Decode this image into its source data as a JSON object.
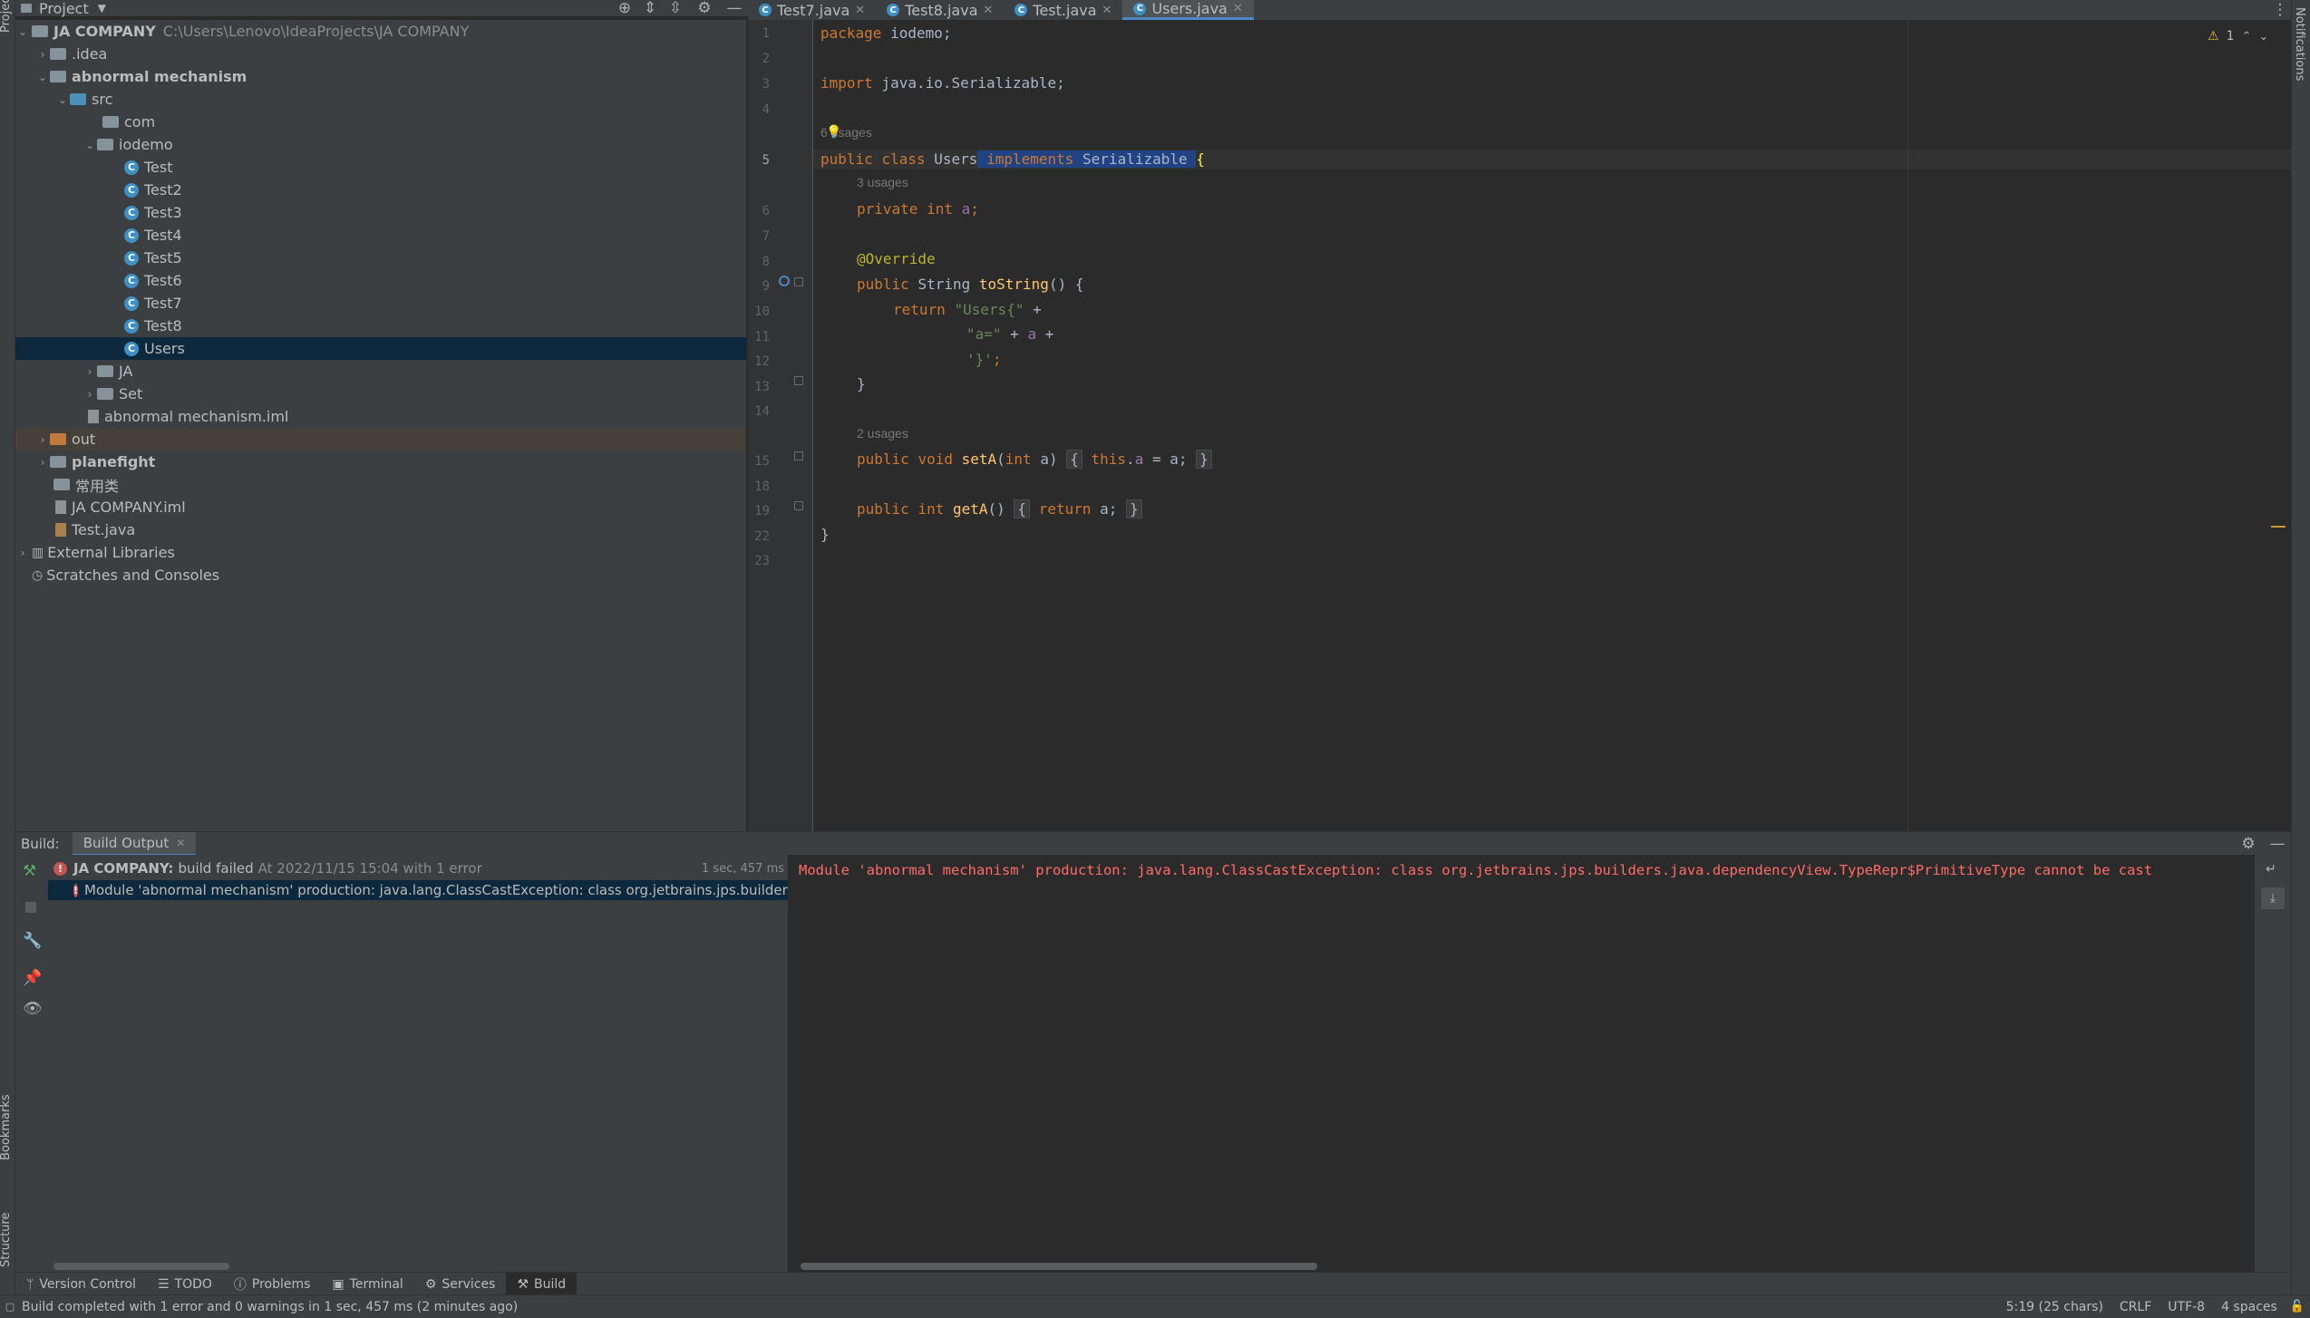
{
  "stripes": {
    "left_top": "Project",
    "left_bookmarks": "Bookmarks",
    "left_structure": "Structure",
    "right_notifications": "Notifications"
  },
  "project_panel": {
    "title": "Project",
    "tree": [
      {
        "label": "JA COMPANY",
        "path": "C:\\Users\\Lenovo\\IdeaProjects\\JA COMPANY"
      },
      {
        "label": ".idea"
      },
      {
        "label": "abnormal mechanism"
      },
      {
        "label": "src"
      },
      {
        "label": "com"
      },
      {
        "label": "iodemo"
      },
      {
        "label": "Test"
      },
      {
        "label": "Test2"
      },
      {
        "label": "Test3"
      },
      {
        "label": "Test4"
      },
      {
        "label": "Test5"
      },
      {
        "label": "Test6"
      },
      {
        "label": "Test7"
      },
      {
        "label": "Test8"
      },
      {
        "label": "Users"
      },
      {
        "label": "JA"
      },
      {
        "label": "Set"
      },
      {
        "label": "abnormal mechanism.iml"
      },
      {
        "label": "out"
      },
      {
        "label": "planefight"
      },
      {
        "label": "常用类"
      },
      {
        "label": "JA COMPANY.iml"
      },
      {
        "label": "Test.java"
      },
      {
        "label": "External Libraries"
      },
      {
        "label": "Scratches and Consoles"
      }
    ]
  },
  "tabs": [
    {
      "label": "Test7.java"
    },
    {
      "label": "Test8.java"
    },
    {
      "label": "Test.java"
    },
    {
      "label": "Users.java"
    }
  ],
  "editor": {
    "warnings_count": "1",
    "line_numbers": [
      "1",
      "2",
      "3",
      "4",
      "5",
      "6",
      "7",
      "8",
      "9",
      "10",
      "11",
      "12",
      "13",
      "14",
      "15",
      "18",
      "19",
      "22",
      "23"
    ],
    "code": {
      "l1_kw": "package",
      "l1_rest": " iodemo;",
      "l3_kw": "import",
      "l3_rest": " java.io.Serializable;",
      "usages_6": "6 usages",
      "l5_kw1": "public",
      "l5_kw2": "class",
      "l5_name": "Users",
      "l5_kw3": "implements",
      "l5_iface": "Serializable",
      "l5_brace": "{",
      "usages_3": "3 usages",
      "l6_kw1": "private",
      "l6_kw2": "int",
      "l6_field": "a",
      "l6_end": ";",
      "l8_ann": "@Override",
      "l9_kw1": "public",
      "l9_type": "String",
      "l9_fn": "toString",
      "l9_rest": "() {",
      "l10_kw": "return",
      "l10_str": "\"Users{\"",
      "l10_rest": " +",
      "l11_str": "\"a=\"",
      "l11_mid": " + ",
      "l11_field": "a",
      "l11_rest": " +",
      "l12_str": "'}'",
      "l12_end": ";",
      "l13": "}",
      "usages_2": "2 usages",
      "l15_kw1": "public",
      "l15_kw2": "void",
      "l15_fn": "setA",
      "l15_p1": "(",
      "l15_kw3": "int",
      "l15_p2": " a)",
      "l15_fold_open": "{",
      "l15_kw4": "this",
      "l15_dot": ".",
      "l15_field": "a",
      "l15_assign": " = a;",
      "l15_fold_close": "}",
      "l19_kw1": "public",
      "l19_kw2": "int",
      "l19_fn": "getA",
      "l19_p": "()",
      "l19_fold_open": "{",
      "l19_kw3": "return",
      "l19_rest": " a;",
      "l19_fold_close": "}",
      "l22": "}"
    }
  },
  "build": {
    "label": "Build:",
    "tab": "Build Output",
    "summary_project": "JA COMPANY:",
    "summary_status": "build failed",
    "summary_time": "At 2022/11/15 15:04 with 1 error",
    "summary_duration": "1 sec, 457 ms",
    "error_item": "Module 'abnormal mechanism' production: java.lang.ClassCastException: class org.jetbrains.jps.builders.ja",
    "console_text": "Module 'abnormal mechanism' production: java.lang.ClassCastException: class org.jetbrains.jps.builders.java.dependencyView.TypeRepr$PrimitiveType cannot be cast"
  },
  "bottom_tabs": [
    {
      "label": "Version Control"
    },
    {
      "label": "TODO"
    },
    {
      "label": "Problems"
    },
    {
      "label": "Terminal"
    },
    {
      "label": "Services"
    },
    {
      "label": "Build"
    }
  ],
  "status_bar": {
    "message": "Build completed with 1 error and 0 warnings in 1 sec, 457 ms (2 minutes ago)",
    "position": "5:19 (25 chars)",
    "line_sep": "CRLF",
    "encoding": "UTF-8",
    "indent": "4 spaces"
  },
  "colors": {
    "accent": "#4a88c7",
    "error": "#c75450",
    "console_error": "#ff6b68",
    "selection": "#0d293e"
  }
}
